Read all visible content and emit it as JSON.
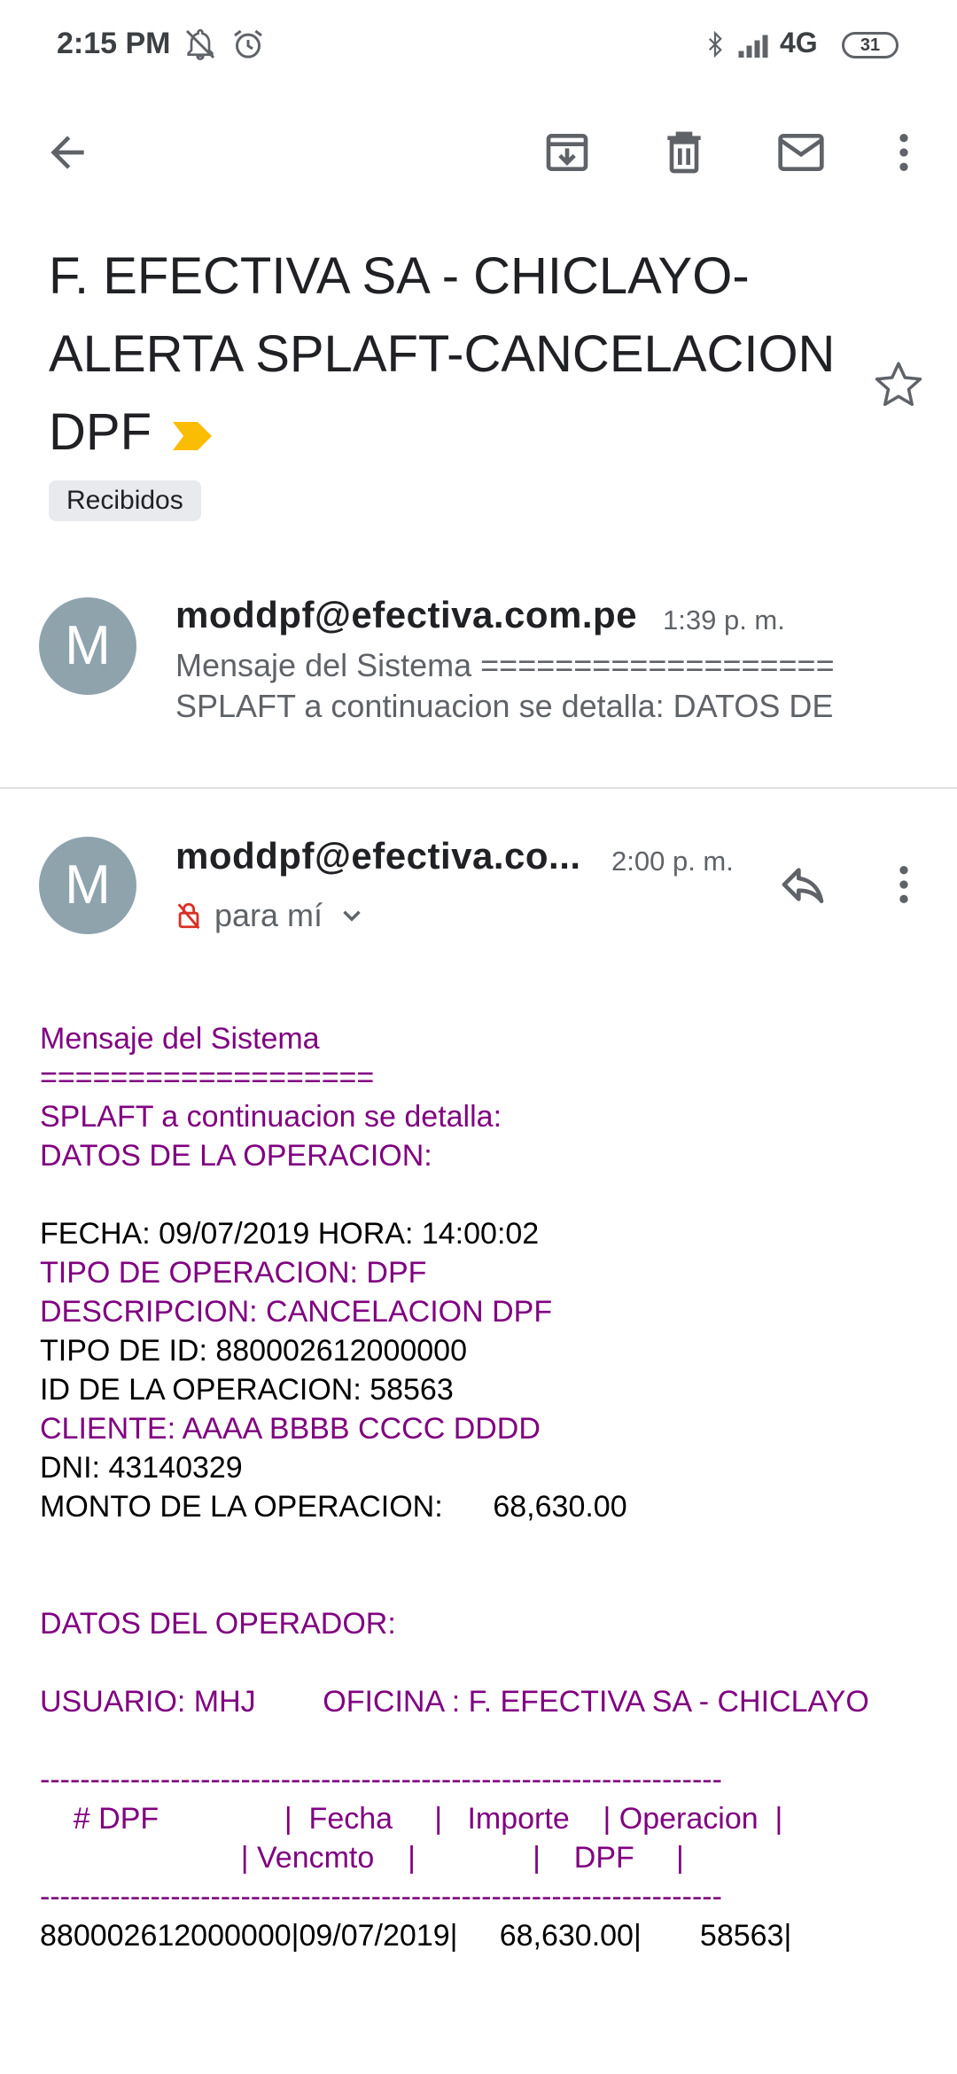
{
  "status_bar": {
    "time": "2:15 PM",
    "network": "4G",
    "battery": "31"
  },
  "toolbar": {
    "icons": [
      "back-arrow-icon",
      "archive-icon",
      "delete-icon",
      "mark-unread-icon",
      "more-vert-icon"
    ]
  },
  "subject": {
    "text": "F. EFECTIVA SA - CHICLAYO-ALERTA SPLAFT-CANCELACION DPF",
    "label": "Recibidos",
    "importance_color": "#fbbc04"
  },
  "message1": {
    "avatar": "M",
    "sender": "moddpf@efectiva.com.pe",
    "time": "1:39 p. m.",
    "snippet_line1": "Mensaje del Sistema ===================",
    "snippet_line2": "SPLAFT a continuacion se detalla: DATOS DE"
  },
  "message2": {
    "avatar": "M",
    "sender": "moddpf@efectiva.co...",
    "time": "2:00 p. m.",
    "recipient": "para mí"
  },
  "body": {
    "lines": [
      {
        "text": "Mensaje del Sistema",
        "color": "purple"
      },
      {
        "text": "===================",
        "color": "purple"
      },
      {
        "text": "SPLAFT a continuacion se detalla:",
        "color": "purple"
      },
      {
        "text": "DATOS DE LA OPERACION:",
        "color": "purple"
      },
      {
        "text": "",
        "color": "black"
      },
      {
        "text": "FECHA: 09/07/2019 HORA: 14:00:02",
        "color": "black"
      },
      {
        "text": "TIPO DE OPERACION: DPF",
        "color": "purple"
      },
      {
        "text": "DESCRIPCION: CANCELACION DPF",
        "color": "purple"
      },
      {
        "text": "TIPO DE ID: 880002612000000",
        "color": "black"
      },
      {
        "text": "ID DE LA OPERACION: 58563",
        "color": "black"
      },
      {
        "text": "CLIENTE: AAAA BBBB CCCC DDDD",
        "color": "purple"
      },
      {
        "text": "DNI: 43140329",
        "color": "black"
      },
      {
        "text": "MONTO DE LA OPERACION:      68,630.00",
        "color": "black"
      },
      {
        "text": "",
        "color": "black"
      },
      {
        "text": "",
        "color": "black"
      },
      {
        "text": "DATOS DEL OPERADOR:",
        "color": "purple"
      },
      {
        "text": "",
        "color": "black"
      },
      {
        "text": "USUARIO: MHJ        OFICINA : F. EFECTIVA SA - CHICLAYO",
        "color": "purple"
      },
      {
        "text": "",
        "color": "black"
      },
      {
        "text": "--------------------------------------------------------------------",
        "color": "purple"
      },
      {
        "text": "    # DPF               |  Fecha     |   Importe    | Operacion  |",
        "color": "purple"
      },
      {
        "text": "                        | Vencmto    |              |    DPF     |",
        "color": "purple"
      },
      {
        "text": "--------------------------------------------------------------------",
        "color": "purple"
      },
      {
        "text": "880002612000000|09/07/2019|     68,630.00|       58563|",
        "color": "black"
      }
    ]
  }
}
